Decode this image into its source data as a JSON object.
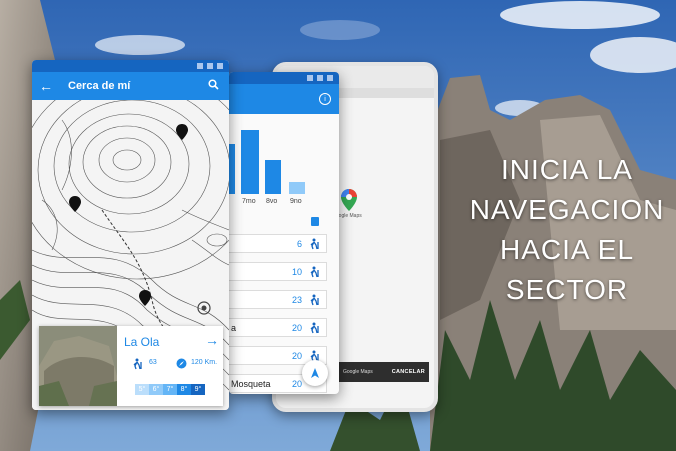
{
  "headline": [
    "INICIA LA",
    "NAVEGACION",
    "HACIA EL",
    "SECTOR"
  ],
  "map_screen": {
    "title": "Cerca de mí",
    "card": {
      "name": "La Ola",
      "routes_count": "63",
      "distance": "120 Km.",
      "grades": [
        "5°",
        "6°",
        "7°",
        "8°",
        "9°"
      ]
    }
  },
  "stats_screen": {
    "chart_labels": [
      "7mo",
      "8vo",
      "9no"
    ],
    "rows": [
      {
        "name": "",
        "count": "6"
      },
      {
        "name": "",
        "count": "10"
      },
      {
        "name": "",
        "count": "23"
      },
      {
        "name": "a",
        "count": "20"
      },
      {
        "name": "",
        "count": "20"
      },
      {
        "name": "Mosqueta",
        "count": "20"
      }
    ]
  },
  "maps_screen": {
    "app_label": "Google Maps",
    "dialog_text": "Google Maps",
    "dialog_action": "CANCELAR"
  },
  "colors": {
    "primary": "#1e88e5",
    "dark": "#1565c0",
    "light": "#90caf9"
  }
}
